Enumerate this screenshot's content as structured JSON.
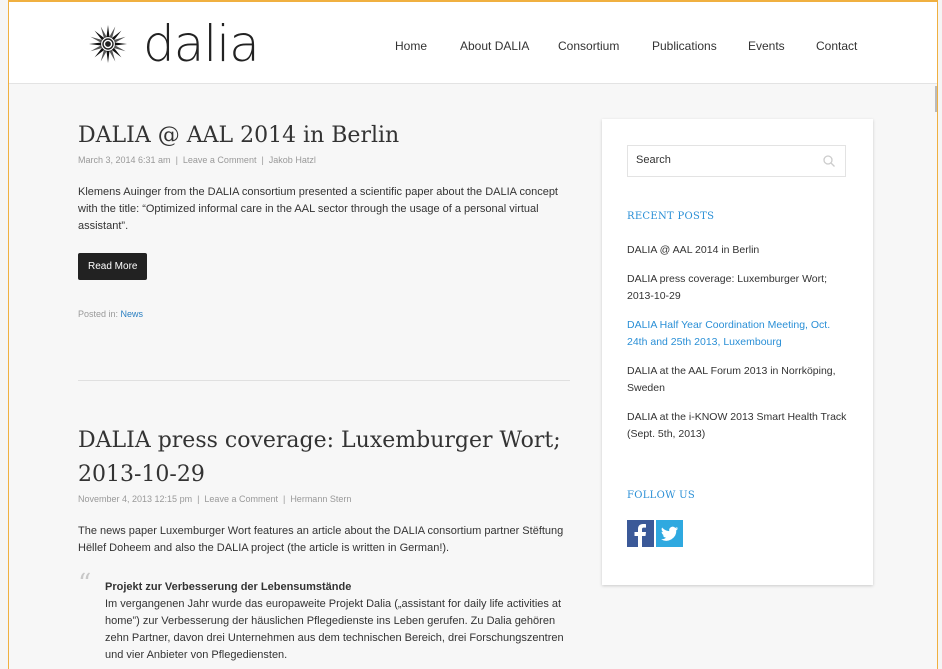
{
  "brand": {
    "logo_text": "dalia"
  },
  "nav": {
    "items": [
      {
        "label": "Home"
      },
      {
        "label": "About DALIA"
      },
      {
        "label": "Consortium"
      },
      {
        "label": "Publications"
      },
      {
        "label": "Events"
      },
      {
        "label": "Contact"
      }
    ]
  },
  "posts": [
    {
      "title": "DALIA @ AAL 2014 in Berlin",
      "date": "March 3, 2014 6:31 am",
      "comments": "Leave a Comment",
      "author": "Jakob Hatzl",
      "body": "Klemens Auinger from the DALIA consortium presented a scientific paper about the DALIA concept with the title: “Optimized informal care in the AAL sector through the usage of a personal virtual assistant”.",
      "read_more": "Read More",
      "posted_in_label": "Posted in:",
      "category": "News"
    },
    {
      "title": "DALIA press coverage: Luxemburger Wort; 2013-10-29",
      "date": "November 4, 2013 12:15 pm",
      "comments": "Leave a Comment",
      "author": "Hermann Stern",
      "body": "The news paper Luxemburger Wort features an article about the DALIA consortium partner Stëftung Hëllef Doheem and also the DALIA project (the article is written in German!).",
      "quote_title": "Projekt zur Verbesserung der Lebensumstände",
      "quote_body": "Im vergangenen Jahr wurde das europaweite Projekt Dalia („assistant for daily life activities at home”) zur Verbesserung der häuslichen Pflegedienste ins Leben gerufen. Zu Dalia gehören zehn Partner, davon drei Unternehmen aus dem technischen Bereich, drei Forschungszentren und vier Anbieter von Pflegediensten."
    }
  ],
  "sidebar": {
    "search_placeholder": "Search",
    "recent_title": "RECENT POSTS",
    "recent_posts": [
      "DALIA @ AAL 2014 in Berlin",
      "DALIA press coverage: Luxemburger Wort; 2013-10-29",
      "DALIA Half Year Coordination Meeting, Oct. 24th and 25th 2013, Luxembourg",
      "DALIA at the AAL Forum 2013 in Norrköping, Sweden",
      "DALIA at the i-KNOW 2013 Smart Health Track (Sept. 5th, 2013)"
    ],
    "follow_title": "FOLLOW US",
    "social": [
      "facebook-icon",
      "twitter-icon"
    ]
  },
  "colors": {
    "accent": "#2a8fd6",
    "button_bg": "#222222",
    "facebook": "#3b5998",
    "twitter": "#2fa9e0"
  }
}
